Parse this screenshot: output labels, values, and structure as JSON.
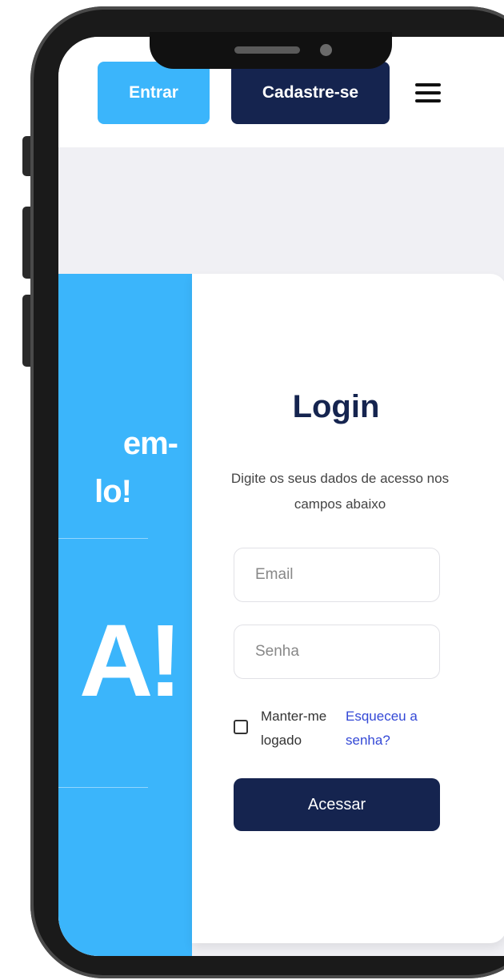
{
  "header": {
    "entrar_label": "Entrar",
    "cadastre_label": "Cadastre-se",
    "menu_icon": "hamburger-menu-icon"
  },
  "promo": {
    "line1": "em-",
    "line2": "lo!",
    "big_text": "A!"
  },
  "login": {
    "title": "Login",
    "subtitle": "Digite os seus dados de acesso nos campos abaixo",
    "email_placeholder": "Email",
    "senha_placeholder": "Senha",
    "remember_label": "Manter-me logado",
    "forgot_label": "Esqueceu a senha?",
    "submit_label": "Acessar"
  },
  "colors": {
    "primary_blue": "#3bb5fb",
    "navy": "#15244f",
    "link_blue": "#3348d6",
    "background_gray": "#f0f0f4"
  }
}
